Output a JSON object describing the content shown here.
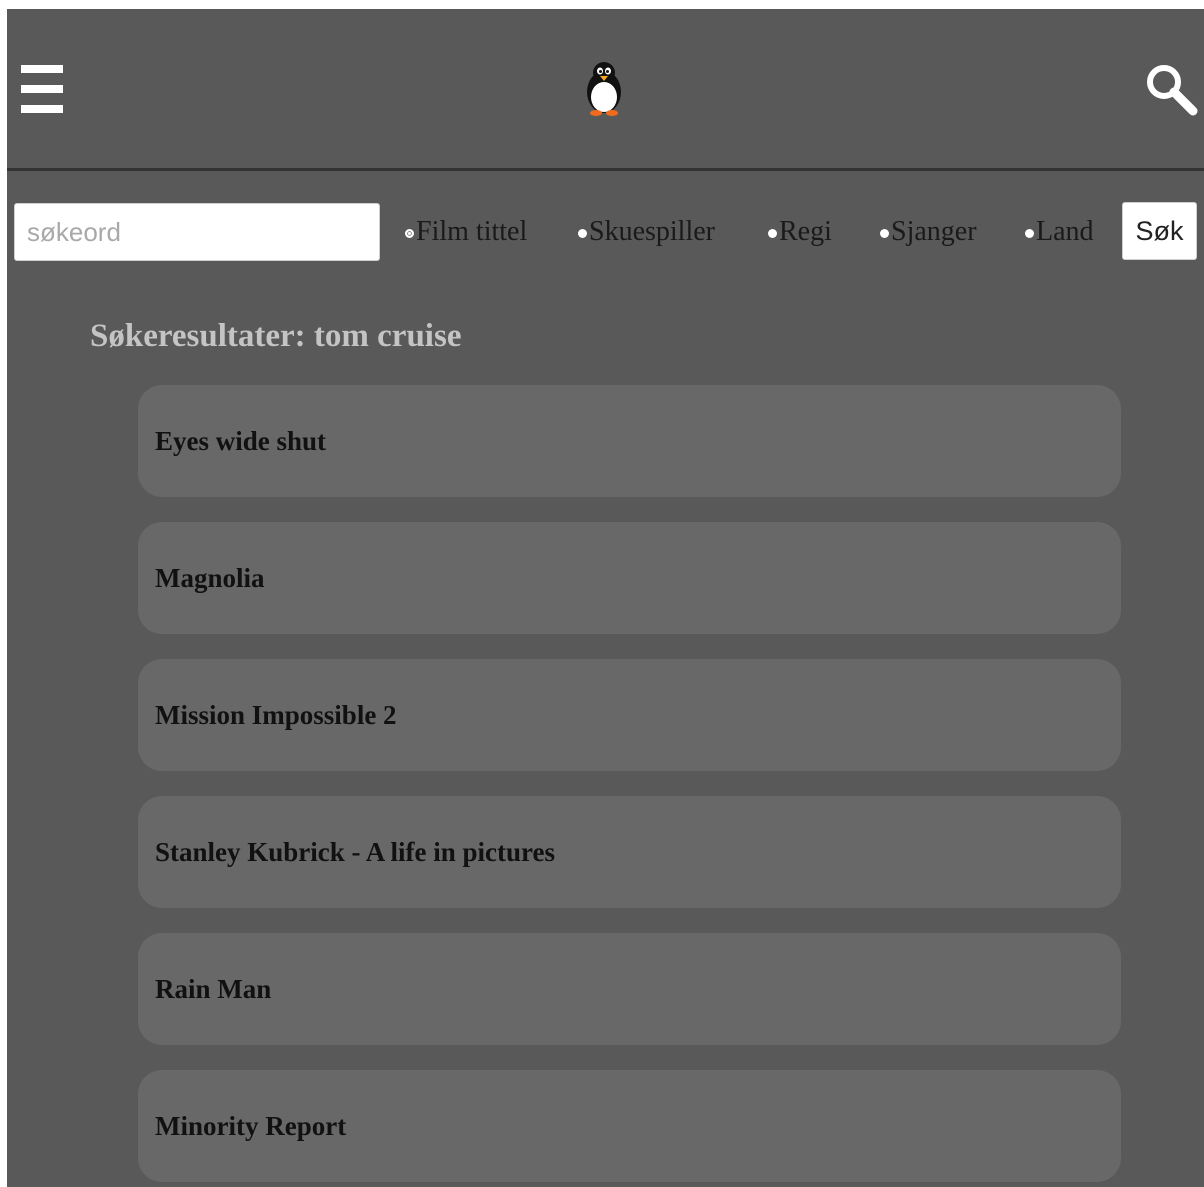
{
  "header": {
    "menu_icon": "hamburger-menu-icon",
    "logo_icon": "penguin-logo-icon",
    "search_icon": "magnifier-icon"
  },
  "search": {
    "placeholder": "søkeord",
    "value": "",
    "filters": [
      {
        "label": "Film tittel",
        "selected": true
      },
      {
        "label": "Skuespiller",
        "selected": false
      },
      {
        "label": "Regi",
        "selected": false
      },
      {
        "label": "Sjanger",
        "selected": false
      },
      {
        "label": "Land",
        "selected": false
      }
    ],
    "submit_label": "Søk"
  },
  "results": {
    "heading": "Søkeresultater: tom cruise",
    "items": [
      {
        "title": "Eyes wide shut"
      },
      {
        "title": "Magnolia"
      },
      {
        "title": "Mission Impossible 2"
      },
      {
        "title": "Stanley Kubrick - A life in pictures"
      },
      {
        "title": "Rain Man"
      },
      {
        "title": "Minority Report"
      }
    ]
  },
  "colors": {
    "background": "#595959",
    "header_border": "#333333",
    "card": "#686868",
    "heading_text": "#c4c4c4",
    "card_text": "#111111"
  }
}
